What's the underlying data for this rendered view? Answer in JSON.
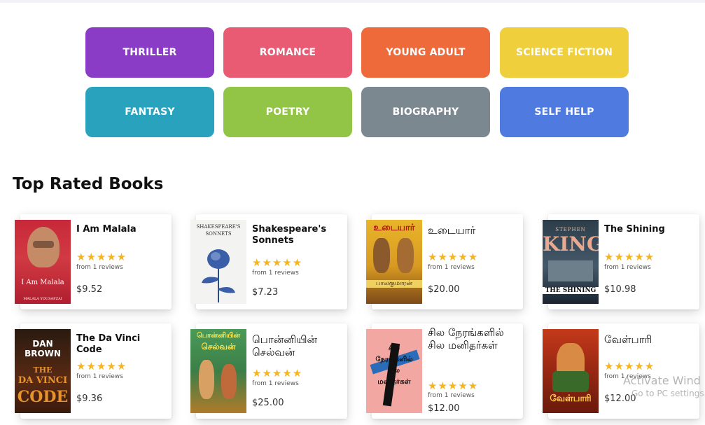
{
  "categories": [
    {
      "label": "THRILLER",
      "color": "#8a3cc7"
    },
    {
      "label": "ROMANCE",
      "color": "#e85b73"
    },
    {
      "label": "YOUNG ADULT",
      "color": "#ee6a3a"
    },
    {
      "label": "SCIENCE FICTION",
      "color": "#f0cf3c"
    },
    {
      "label": "FANTASY",
      "color": "#29a2bd"
    },
    {
      "label": "POETRY",
      "color": "#92c446"
    },
    {
      "label": "BIOGRAPHY",
      "color": "#7b8890"
    },
    {
      "label": "SELF HELP",
      "color": "#4f7adf"
    }
  ],
  "top_rated": {
    "heading": "Top Rated Books",
    "books": [
      {
        "title": "I Am Malala",
        "stars": "★★★★★",
        "reviews": "from 1 reviews",
        "price": "$9.52",
        "cover_text": [
          "I Am Malala",
          "MALALA YOUSAFZAI"
        ]
      },
      {
        "title": "Shakespeare's Sonnets",
        "stars": "★★★★★",
        "reviews": "from 1 reviews",
        "price": "$7.23",
        "cover_text": [
          "SHAKESPEARE'S",
          "SONNETS"
        ]
      },
      {
        "title": "உடையார்",
        "stars": "★★★★★",
        "reviews": "from 1 reviews",
        "price": "$20.00",
        "cover_text": [
          "உடையார்",
          "பாலகுமாரன்"
        ]
      },
      {
        "title": "The Shining",
        "stars": "★★★★★",
        "reviews": "from 1 reviews",
        "price": "$10.98",
        "cover_text": [
          "STEPHEN",
          "KING",
          "THE SHINING"
        ]
      },
      {
        "title": "The Da Vinci Code",
        "stars": "★★★★★",
        "reviews": "from 1 reviews",
        "price": "$9.36",
        "cover_text": [
          "DAN BROWN",
          "THE",
          "DA VINCI",
          "CODE"
        ]
      },
      {
        "title": "பொன்னியின் செல்வன்",
        "stars": "★★★★★",
        "reviews": "from 1 reviews",
        "price": "$25.00",
        "cover_text": [
          "பொன்னியின்",
          "செல்வன்"
        ]
      },
      {
        "title": "சில நேரங்களில் சில மனிதர்கள்",
        "stars": "★★★★★",
        "reviews": "from 1 reviews",
        "price": "$12.00",
        "cover_text": [
          "சில",
          "நேரங்களில்",
          "சில",
          "மனிதர்கள்"
        ]
      },
      {
        "title": "வேள்பாரி",
        "stars": "★★★★★",
        "reviews": "from 1 reviews",
        "price": "$12.00",
        "cover_text": [
          "வேள்பாரி"
        ]
      }
    ]
  },
  "watermark": {
    "line1": "Activate Wind",
    "line2": "Go to PC settings"
  }
}
